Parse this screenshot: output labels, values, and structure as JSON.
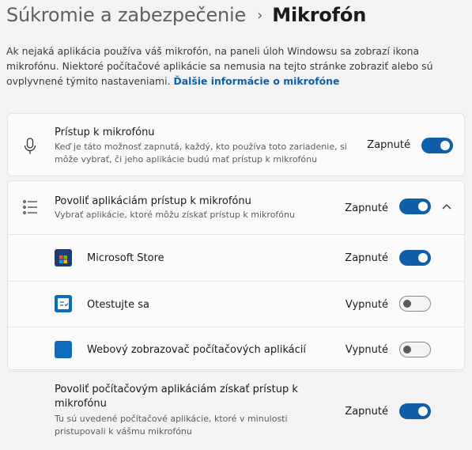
{
  "header": {
    "breadcrumb_parent": "Súkromie a zabezpečenie",
    "breadcrumb_separator": "›",
    "page_title": "Mikrofón"
  },
  "description": {
    "text": "Ak nejaká aplikácia používa váš mikrofón, na paneli úloh Windowsu sa zobrazí ikona mikrofónu. Niektoré počítačové aplikácie sa nemusia na tejto stránke zobraziť alebo sú ovplyvnené týmito nastaveniami.",
    "link": "Ďalšie informácie o mikrofóne"
  },
  "microphone_access": {
    "title": "Prístup k mikrofónu",
    "subtitle_line1": "Keď je táto možnosť zapnutá, každý, kto používa toto zariadenie, si",
    "subtitle_line2": "môže vybrať, či jeho aplikácie budú mať prístup k mikrofónu",
    "state": "Zapnuté",
    "on": true
  },
  "app_access": {
    "title": "Povoliť aplikáciám prístup k mikrofónu",
    "subtitle": "Vybrať aplikácie, ktoré môžu získať prístup k mikrofónu",
    "state": "Zapnuté",
    "on": true,
    "apps": [
      {
        "name": "Microsoft Store",
        "state": "Zapnuté",
        "on": true,
        "icon": "microsoft-store-icon"
      },
      {
        "name": "Otestujte sa",
        "state": "Vypnuté",
        "on": false,
        "icon": "test-app-icon"
      },
      {
        "name": "Webový zobrazovač počítačových aplikácií",
        "state": "Vypnuté",
        "on": false,
        "icon": "webview-app-icon"
      }
    ]
  },
  "desktop_access": {
    "title_line1": "Povoliť počítačovým aplikáciám získať prístup k",
    "title_line2": "mikrofónu",
    "subtitle_line1": "Tu sú uvedené počítačové aplikácie, ktoré v minulosti",
    "subtitle_line2": "pristupovali k vášmu mikrofónu",
    "state": "Zapnuté",
    "on": true
  },
  "colors": {
    "accent": "#0f5ea8",
    "background": "#f3f3f3",
    "card": "#fbfbfb"
  }
}
